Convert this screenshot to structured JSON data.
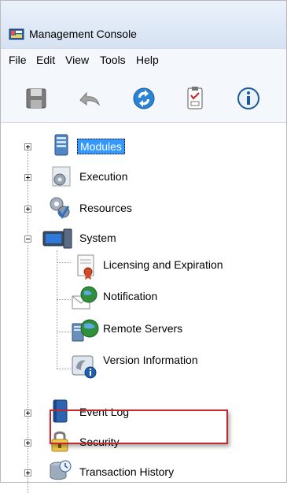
{
  "window": {
    "title": "Management Console"
  },
  "menu": [
    "File",
    "Edit",
    "View",
    "Tools",
    "Help"
  ],
  "toolbar": {
    "buttons": [
      {
        "icon": "save-icon"
      },
      {
        "icon": "undo-icon"
      },
      {
        "icon": "refresh-icon"
      },
      {
        "icon": "clipboard-icon"
      },
      {
        "icon": "info-icon"
      }
    ]
  },
  "tree": {
    "items": [
      {
        "label": "Modules",
        "expanded": false,
        "selected": true
      },
      {
        "label": "Execution",
        "expanded": false
      },
      {
        "label": "Resources",
        "expanded": false
      },
      {
        "label": "System",
        "expanded": true,
        "children": [
          {
            "label": "Licensing and Expiration"
          },
          {
            "label": "Notification"
          },
          {
            "label": "Remote Servers",
            "highlighted": true
          },
          {
            "label": "Version Information"
          }
        ]
      },
      {
        "label": "Event Log",
        "expanded": false
      },
      {
        "label": "Security",
        "expanded": false
      },
      {
        "label": "Transaction History",
        "expanded": false
      }
    ]
  },
  "colors": {
    "selection": "#3399ff",
    "highlight_border": "#c0282e"
  }
}
